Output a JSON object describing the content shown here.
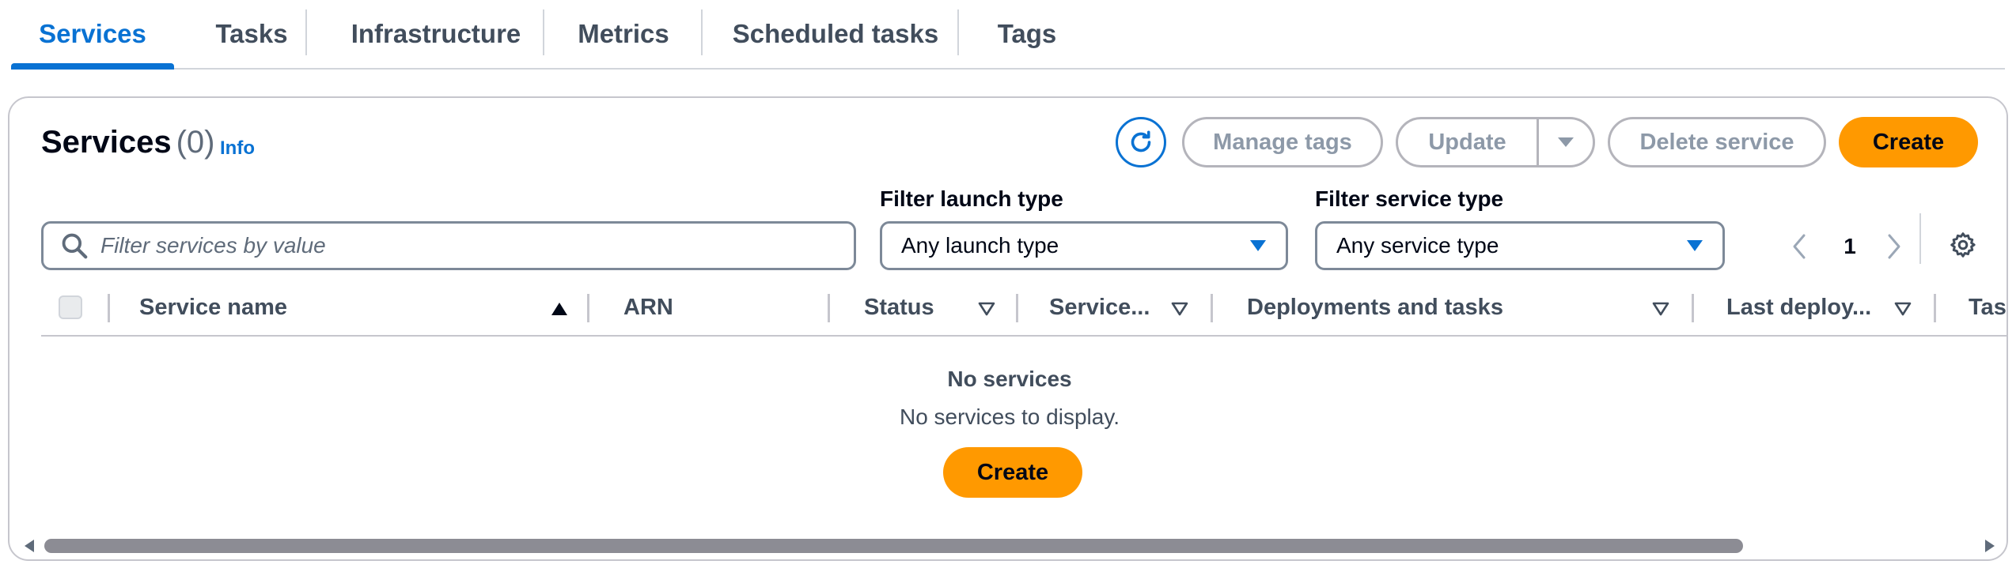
{
  "tabs": [
    {
      "label": "Services",
      "active": true
    },
    {
      "label": "Tasks"
    },
    {
      "label": "Infrastructure"
    },
    {
      "label": "Metrics"
    },
    {
      "label": "Scheduled tasks"
    },
    {
      "label": "Tags"
    }
  ],
  "panel": {
    "title": "Services",
    "count": "(0)",
    "info_link": "Info"
  },
  "actions": {
    "refresh_icon": "refresh-icon",
    "manage_tags": "Manage tags",
    "update": "Update",
    "delete_service": "Delete service",
    "create": "Create"
  },
  "filters": {
    "search_placeholder": "Filter services by value",
    "launch_type_label": "Filter launch type",
    "launch_type_value": "Any launch type",
    "service_type_label": "Filter service type",
    "service_type_value": "Any service type"
  },
  "pagination": {
    "current_page": "1"
  },
  "table": {
    "columns": [
      "Service name",
      "ARN",
      "Status",
      "Service...",
      "Deployments and tasks",
      "Last deploy...",
      "Task"
    ]
  },
  "empty_state": {
    "title": "No services",
    "description": "No services to display.",
    "create": "Create"
  },
  "scrollbar": {
    "position_fraction": 0.0,
    "visible_fraction": 0.88
  },
  "colors": {
    "accent": "#0972d3",
    "primary_button": "#ff9900",
    "disabled_text": "#8d99a8",
    "border": "#7d8998"
  }
}
